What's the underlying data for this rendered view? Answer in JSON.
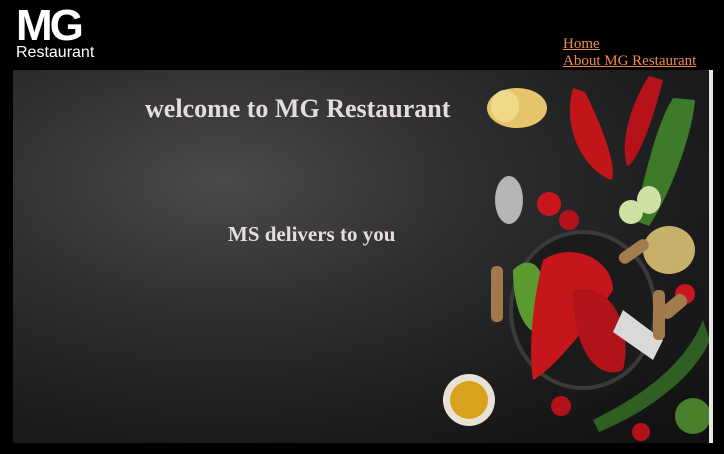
{
  "brand": {
    "logo_mark": "MG",
    "logo_word": "Restaurant"
  },
  "nav": {
    "items": [
      {
        "label": "Home"
      },
      {
        "label": "About MG Restaurant"
      }
    ]
  },
  "hero": {
    "headline": "welcome to MG Restaurant",
    "tagline": "MS delivers to you"
  },
  "colors": {
    "background": "#000000",
    "link": "#f08a4b",
    "hero_text": "#e4dcde"
  }
}
